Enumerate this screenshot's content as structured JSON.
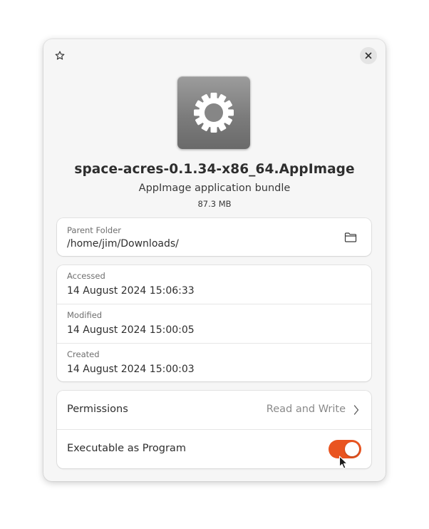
{
  "header": {
    "star_icon": "star-icon",
    "close_icon": "close-icon"
  },
  "file": {
    "icon": "gear-icon",
    "name": "space-acres-0.1.34-x86_64.AppImage",
    "type": "AppImage application bundle",
    "size": "87.3 MB"
  },
  "location": {
    "label": "Parent Folder",
    "path": "/home/jim/Downloads/",
    "open_icon": "folder-icon"
  },
  "dates": [
    {
      "label": "Accessed",
      "value": "14 August 2024 15:06:33"
    },
    {
      "label": "Modified",
      "value": "14 August 2024 15:00:05"
    },
    {
      "label": "Created",
      "value": "14 August 2024 15:00:03"
    }
  ],
  "permissions": {
    "label": "Permissions",
    "value": "Read and Write",
    "executable_label": "Executable as Program",
    "executable_on": true
  },
  "colors": {
    "accent": "#e95420",
    "window_bg": "#f6f6f6",
    "card_bg": "#ffffff"
  }
}
